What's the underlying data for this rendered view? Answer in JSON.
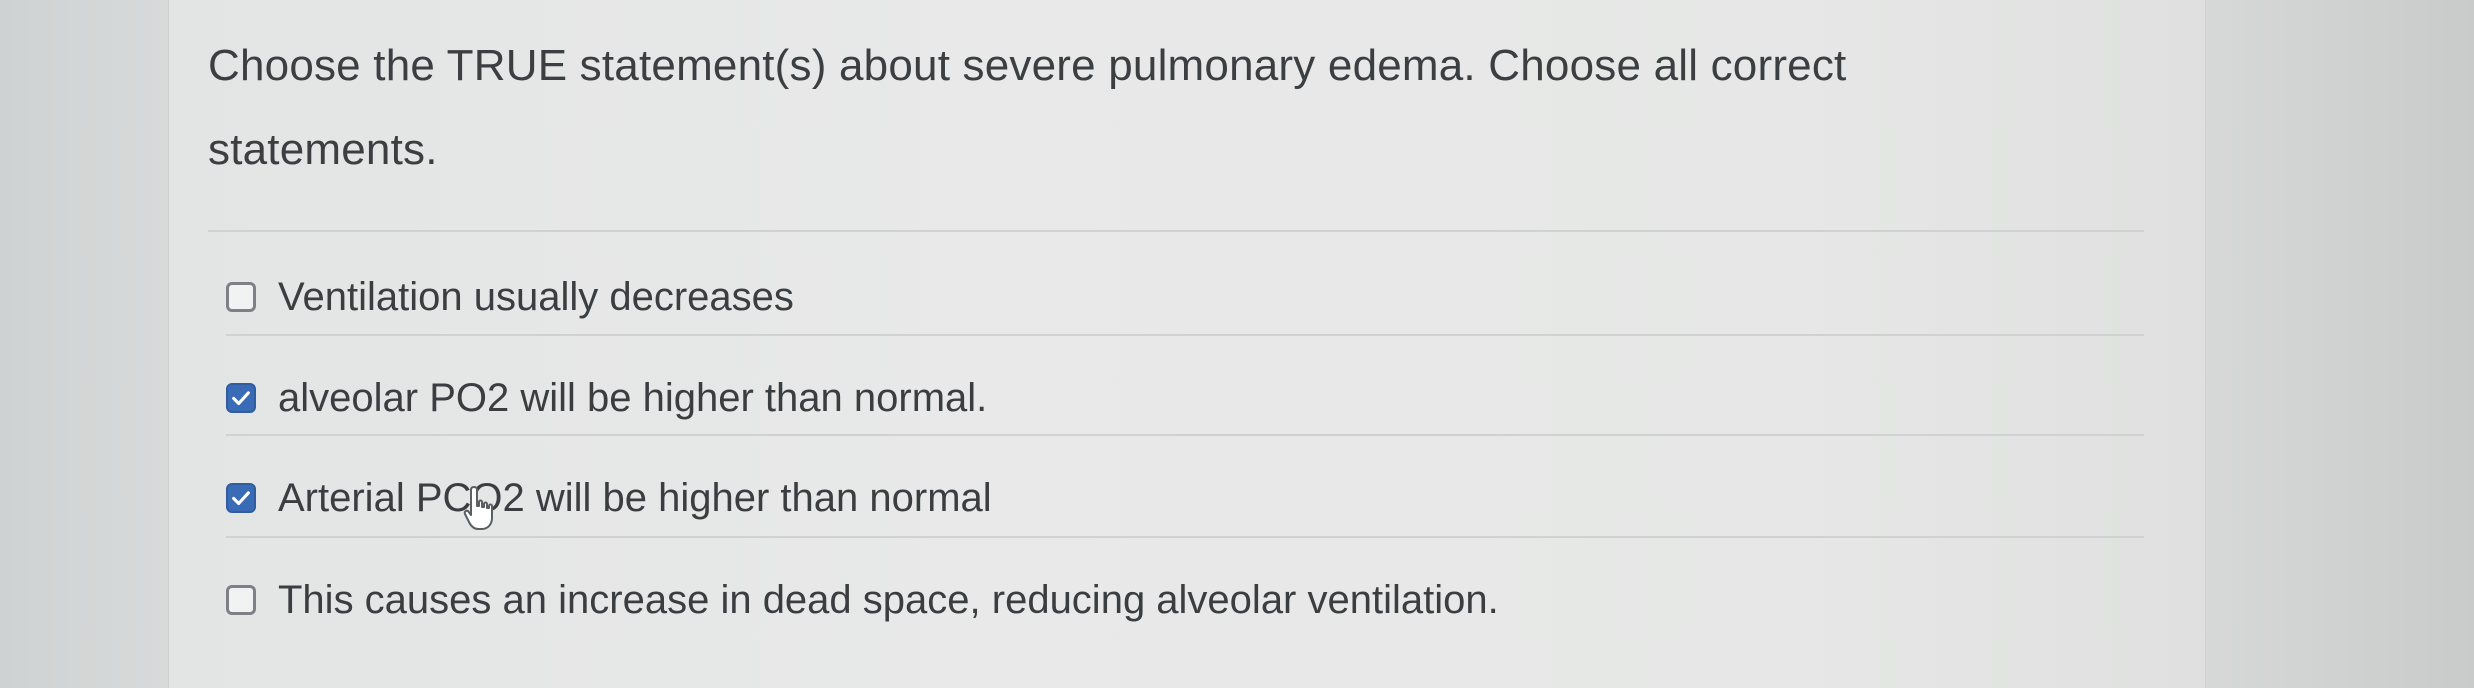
{
  "question": {
    "text": "Choose the TRUE statement(s) about severe pulmonary edema. Choose all correct statements."
  },
  "options": [
    {
      "label": "Ventilation usually decreases",
      "checked": false
    },
    {
      "label": "alveolar PO2 will be higher than normal.",
      "checked": true
    },
    {
      "label": "Arterial PCO2 will be higher than normal",
      "checked": true
    },
    {
      "label": "This causes an increase in dead space, reducing alveolar ventilation.",
      "checked": false
    }
  ],
  "colors": {
    "checkbox_checked": "#3a6bb7",
    "text": "#3b3e41"
  },
  "icons": {
    "checkmark": "check-icon",
    "cursor": "hand-pointer-icon"
  }
}
